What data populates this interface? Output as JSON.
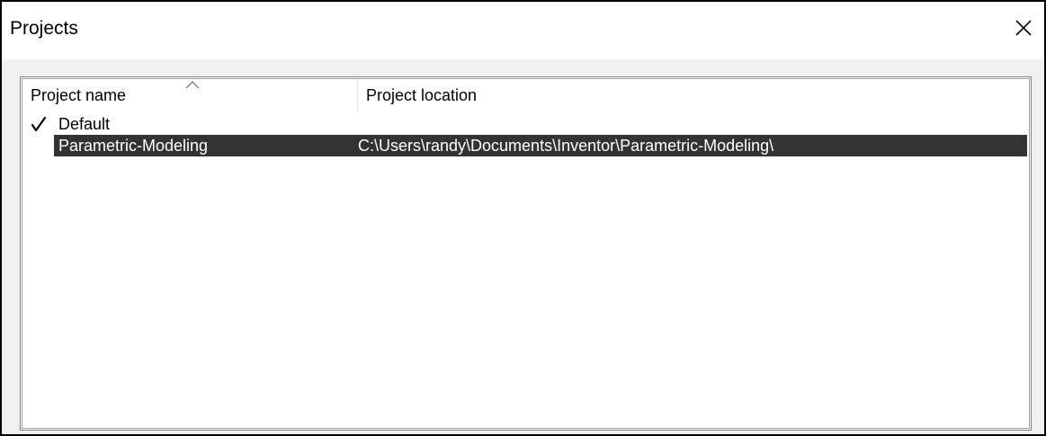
{
  "window": {
    "title": "Projects"
  },
  "list": {
    "columns": [
      {
        "label": "Project name",
        "sorted": "ascending"
      },
      {
        "label": "Project location"
      }
    ],
    "rows": [
      {
        "name": "Default",
        "location": "",
        "active": true,
        "selected": false
      },
      {
        "name": "Parametric-Modeling",
        "location": "C:\\Users\\randy\\Documents\\Inventor\\Parametric-Modeling\\",
        "active": false,
        "selected": true
      }
    ]
  },
  "icons": {
    "close": "close-icon",
    "sort": "sort-ascending-icon",
    "check": "checkmark-icon"
  },
  "colors": {
    "selection_bg": "#333333",
    "selection_text": "#ffffff",
    "dialog_bg": "#f0f0f0"
  }
}
